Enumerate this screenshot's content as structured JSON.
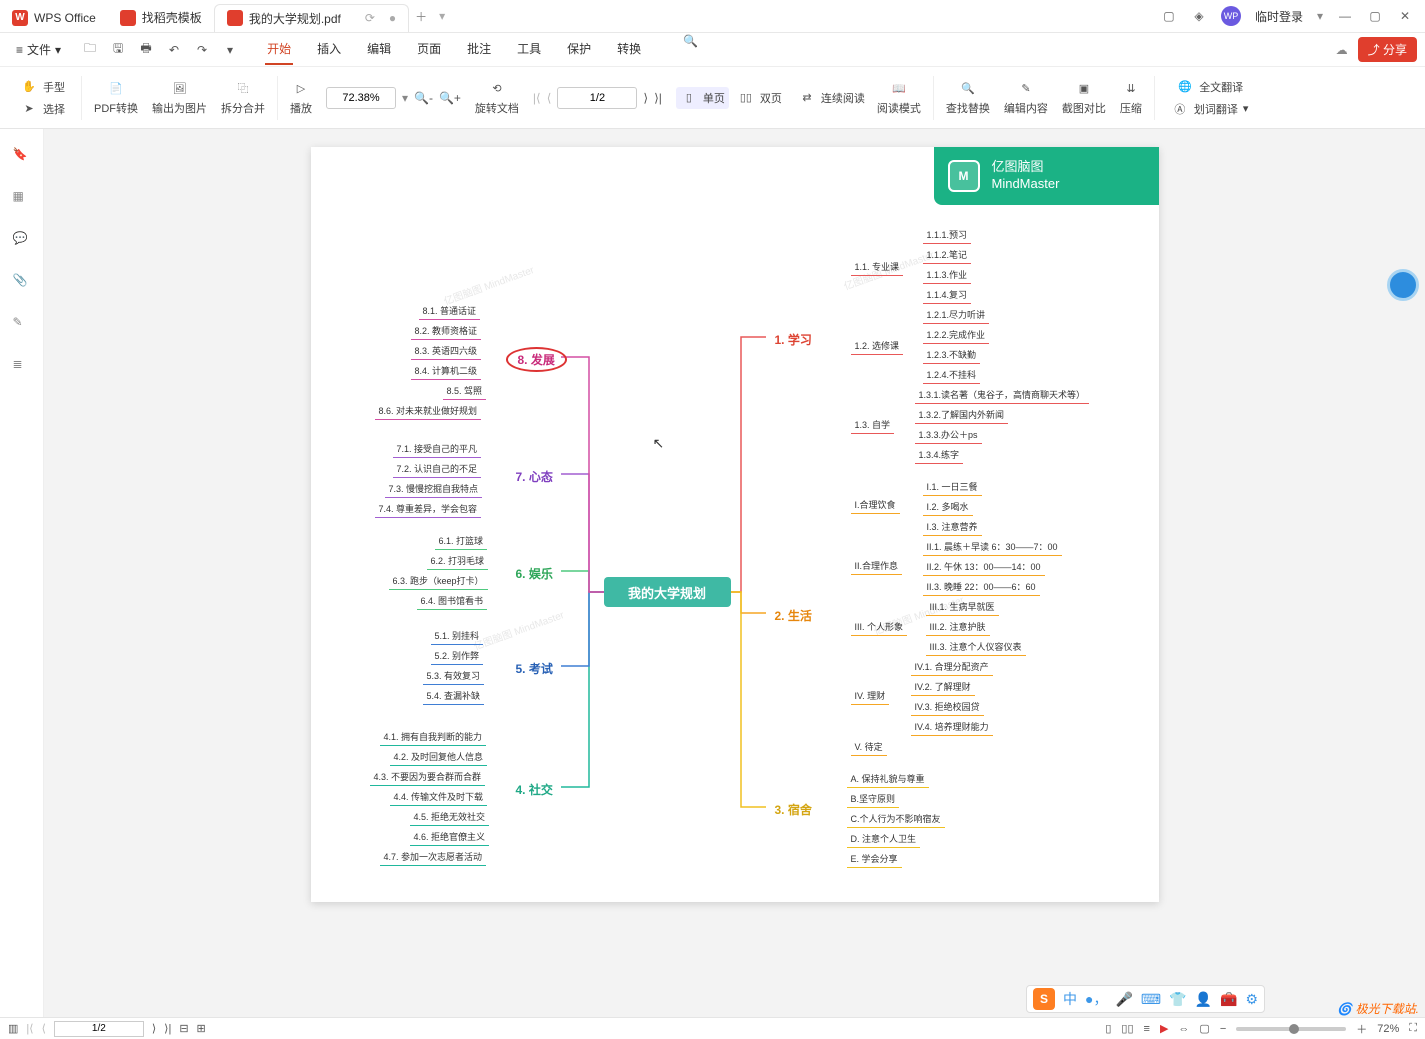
{
  "title_bar": {
    "app_tab": "WPS Office",
    "template_tab": "找稻壳模板",
    "doc_tab": "我的大学规划.pdf",
    "login_label": "临时登录"
  },
  "menu_bar": {
    "file_label": "文件",
    "tabs": [
      "开始",
      "插入",
      "编辑",
      "页面",
      "批注",
      "工具",
      "保护",
      "转换"
    ]
  },
  "ribbon": {
    "left": {
      "hand": "手型",
      "select": "选择"
    },
    "convert": "PDF转换",
    "export_img": "输出为图片",
    "split_merge": "拆分合并",
    "play": "播放",
    "zoom": "72.38%",
    "rotate": "旋转文档",
    "single": "单页",
    "double": "双页",
    "continuous": "连续阅读",
    "reading": "阅读模式",
    "find": "查找替换",
    "edit_content": "编辑内容",
    "compare": "截图对比",
    "compress": "压缩",
    "full_translate": "全文翻译",
    "word_translate": "划词翻译",
    "page": "1/2"
  },
  "mindmap": {
    "badge_cn": "亿图脑图",
    "badge_en": "MindMaster",
    "center": "我的大学规划",
    "b1": {
      "label": "1. 学习",
      "n11": "1.1. 专业课",
      "n111": "1.1.1.预习",
      "n112": "1.1.2.笔记",
      "n113": "1.1.3.作业",
      "n114": "1.1.4.复习",
      "n12": "1.2. 选修课",
      "n121": "1.2.1.尽力听讲",
      "n122": "1.2.2.完成作业",
      "n123": "1.2.3.不缺勤",
      "n124": "1.2.4.不挂科",
      "n13": "1.3. 自学",
      "n131": "1.3.1.读名著（鬼谷子，高情商聊天术等）",
      "n132": "1.3.2.了解国内外新闻",
      "n133": "1.3.3.办公＋ps",
      "n134": "1.3.4.练字"
    },
    "b2": {
      "label": "2. 生活",
      "n21": "I.合理饮食",
      "n211": "I.1. 一日三餐",
      "n212": "I.2. 多喝水",
      "n213": "I.3. 注意营养",
      "n22": "II.合理作息",
      "n221": "II.1. 晨练＋早读 6：30——7：00",
      "n222": "II.2. 午休 13：00——14：00",
      "n223": "II.3. 晚睡 22：00——6：60",
      "n23": "III. 个人形象",
      "n231": "III.1. 生病早就医",
      "n232": "III.2. 注意护肤",
      "n233": "III.3. 注意个人仪容仪表",
      "n24": "IV. 理财",
      "n241": "IV.1. 合理分配资产",
      "n242": "IV.2. 了解理财",
      "n243": "IV.3. 拒绝校园贷",
      "n244": "IV.4. 培养理财能力",
      "n25": "V. 待定"
    },
    "b3": {
      "label": "3. 宿舍",
      "n31": "A. 保持礼貌与尊重",
      "n32": "B.坚守原则",
      "n33": "C.个人行为不影响宿友",
      "n34": "D. 注意个人卫生",
      "n35": "E. 学会分享"
    },
    "b4": {
      "label": "4. 社交",
      "n41": "4.1. 拥有自我判断的能力",
      "n42": "4.2. 及时回复他人信息",
      "n43": "4.3. 不要因为要合群而合群",
      "n44": "4.4. 传输文件及时下载",
      "n45": "4.5. 拒绝无效社交",
      "n46": "4.6. 拒绝官僚主义",
      "n47": "4.7. 参加一次志愿者活动"
    },
    "b5": {
      "label": "5. 考试",
      "n51": "5.1. 别挂科",
      "n52": "5.2. 别作弊",
      "n53": "5.3. 有效复习",
      "n54": "5.4. 查漏补缺"
    },
    "b6": {
      "label": "6. 娱乐",
      "n61": "6.1. 打篮球",
      "n62": "6.2. 打羽毛球",
      "n63": "6.3. 跑步（keep打卡）",
      "n64": "6.4. 图书馆看书"
    },
    "b7": {
      "label": "7. 心态",
      "n71": "7.1. 接受自己的平凡",
      "n72": "7.2. 认识自己的不足",
      "n73": "7.3. 慢慢挖掘自我特点",
      "n74": "7.4. 尊重差异，学会包容"
    },
    "b8": {
      "label": "8. 发展",
      "n81": "8.1. 普通话证",
      "n82": "8.2. 教师资格证",
      "n83": "8.3. 英语四六级",
      "n84": "8.4. 计算机二级",
      "n85": "8.5. 驾照",
      "n86": "8.6. 对未来就业做好规划"
    }
  },
  "status": {
    "page": "1/2",
    "zoom": "72%"
  },
  "ime": {
    "lang": "中"
  },
  "watermark_site": "极光下载站",
  "watermark": "亿图脑图 MindMaster"
}
